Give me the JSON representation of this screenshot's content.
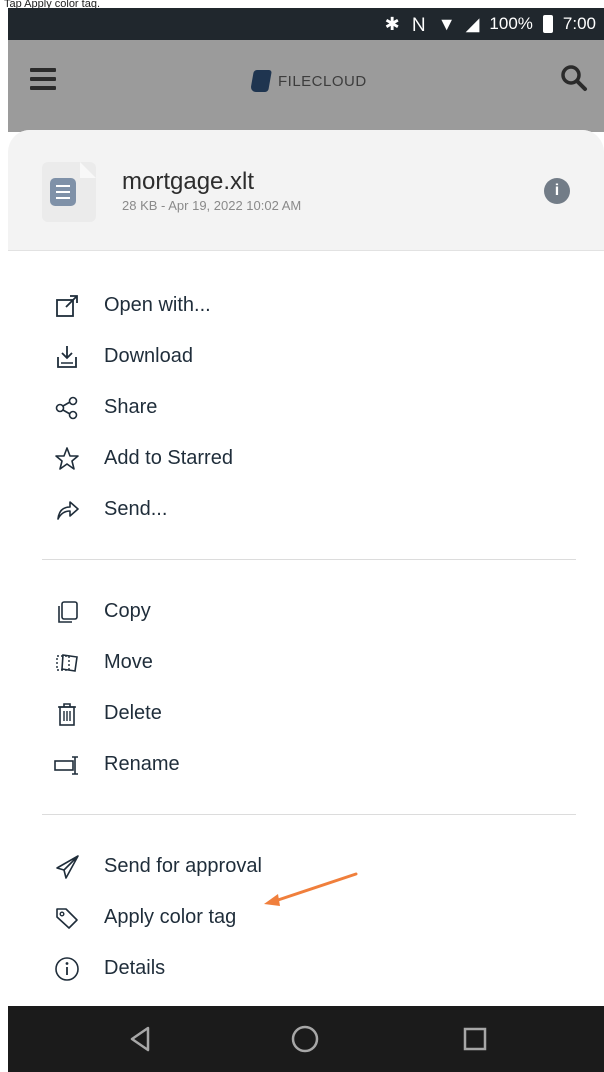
{
  "top_caption": "Tap Apply color tag.",
  "status_bar": {
    "battery": "100%",
    "time": "7:00",
    "icons": [
      "bluetooth-icon",
      "nfc-icon",
      "wifi-icon",
      "signal-icon",
      "battery-icon"
    ]
  },
  "app_bar": {
    "logo_text": "FILECLOUD",
    "menu_icon": "hamburger-menu-icon",
    "search_icon": "search-icon"
  },
  "file": {
    "name": "mortgage.xlt",
    "meta": "28 KB - Apr 19, 2022 10:02 AM",
    "info_icon": "info-icon"
  },
  "menu": {
    "group1": [
      {
        "label": "Open with...",
        "icon": "open-with-icon"
      },
      {
        "label": "Download",
        "icon": "download-icon"
      },
      {
        "label": "Share",
        "icon": "share-icon"
      },
      {
        "label": "Add to Starred",
        "icon": "star-icon"
      },
      {
        "label": "Send...",
        "icon": "send-icon"
      }
    ],
    "group2": [
      {
        "label": "Copy",
        "icon": "copy-icon"
      },
      {
        "label": "Move",
        "icon": "move-icon"
      },
      {
        "label": "Delete",
        "icon": "trash-icon"
      },
      {
        "label": "Rename",
        "icon": "rename-icon"
      }
    ],
    "group3": [
      {
        "label": "Send for approval",
        "icon": "paper-plane-icon"
      },
      {
        "label": "Apply color tag",
        "icon": "tag-icon"
      },
      {
        "label": "Details",
        "icon": "info-circle-icon"
      }
    ]
  },
  "nav_bar": {
    "back": "back-icon",
    "home": "home-icon",
    "recents": "recents-icon"
  },
  "colors": {
    "status_bar_bg": "#20272d",
    "app_bar_bg": "#9b9b9b",
    "annotation_arrow": "#f07f3c"
  }
}
